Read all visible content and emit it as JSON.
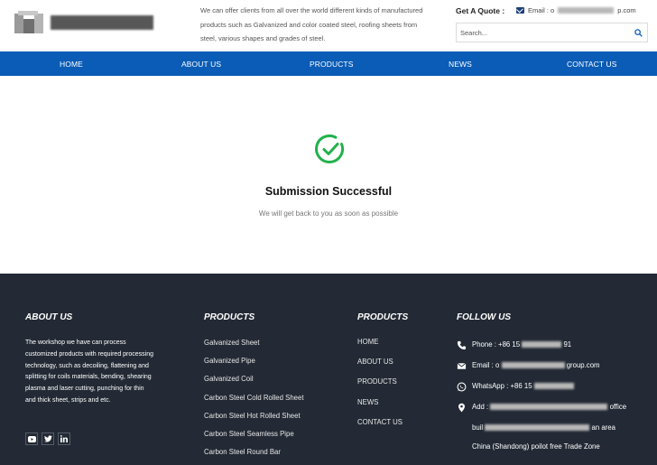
{
  "header": {
    "intro": "We can offer clients from all over the world different kinds of manufactured products such as Galvanized and color coated steel, roofing sheets from steel, various shapes and grades of steel.",
    "quote_label": "Get A Quote :",
    "email_prefix": "Email : o",
    "email_suffix": "p.com",
    "search_placeholder": "Search..."
  },
  "nav": {
    "items": [
      {
        "label": "HOME"
      },
      {
        "label": "ABOUT US"
      },
      {
        "label": "PRODUCTS"
      },
      {
        "label": "NEWS"
      },
      {
        "label": "CONTACT US"
      }
    ]
  },
  "main": {
    "title": "Submission Successful",
    "subtitle": "We will get back to you as soon as possible"
  },
  "footer": {
    "about": {
      "heading": "ABOUT US",
      "text": "The workshop we have can process customized products with required processing technology, such as decoiling, flattening and splitting for coils materials, bending, shearing plasma and laser cutting, punching for thin and thick sheet, strips and etc."
    },
    "products": {
      "heading": "PRODUCTS",
      "items": [
        "Galvanized Sheet",
        "Galvanized Pipe",
        "Galvanized Coil",
        "Carbon Steel Cold Rolled Sheet",
        "Carbon Steel Hot Rolled Sheet",
        "Carbon Steel Seamless Pipe",
        "Carbon Steel Round Bar"
      ]
    },
    "links": {
      "heading": "PRODUCTS",
      "items": [
        "HOME",
        "ABOUT US",
        "PRODUCTS",
        "NEWS",
        "CONTACT US"
      ]
    },
    "follow": {
      "heading": "FOLLOW US",
      "phone_prefix": "Phone : +86 15",
      "phone_suffix": "91",
      "email_prefix": "Email : o",
      "email_suffix": "group.com",
      "whatsapp_prefix": "WhatsApp : +86 15",
      "address_prefix": "Add :",
      "address_suffix": "office",
      "address_line2_prefix": "buil",
      "address_line2_suffix": "an area",
      "address_line3": "China (Shandong) poilot free Trade Zone"
    },
    "social": [
      "youtube-icon",
      "twitter-icon",
      "linkedin-icon"
    ]
  },
  "colors": {
    "nav_bg": "#0a5cb6",
    "footer_bg": "#232a35",
    "success_green": "#22b14c"
  }
}
